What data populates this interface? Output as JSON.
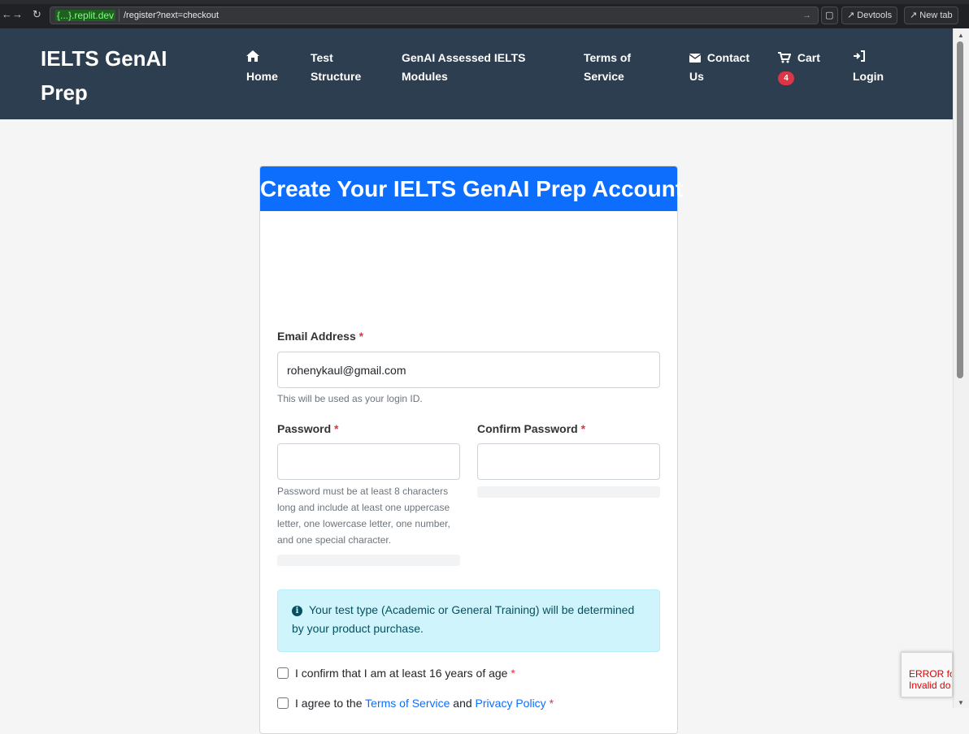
{
  "browser": {
    "url_host": "{...}.replit.dev",
    "url_path": "/register?next=checkout",
    "devtools_label": "Devtools",
    "new_tab_label": "New tab"
  },
  "navbar": {
    "brand": "IELTS GenAI Prep",
    "items": [
      {
        "icon": "home-icon",
        "label": "Home"
      },
      {
        "label": "Test Structure"
      },
      {
        "label": "GenAI Assessed IELTS Modules"
      },
      {
        "label": "Terms of Service"
      },
      {
        "icon": "envelope-icon",
        "label": "Contact Us"
      },
      {
        "icon": "cart-icon",
        "label": "Cart",
        "badge": "4"
      },
      {
        "icon": "sign-in-icon",
        "label": "Login"
      }
    ]
  },
  "form": {
    "title": "Create Your IELTS GenAI Prep Account",
    "email_label": "Email Address",
    "email_value": "rohenykaul@gmail.com",
    "email_help": "This will be used as your login ID.",
    "password_label": "Password",
    "password_help": "Password must be at least 8 characters long and include at least one uppercase letter, one lowercase letter, one number, and one special character.",
    "confirm_label": "Confirm Password",
    "required_marker": "*",
    "info_text": "Your test type (Academic or General Training) will be determined by your product purchase.",
    "age_check_label": "I confirm that I am at least 16 years of age",
    "terms_prefix": "I agree to the",
    "terms_link": "Terms of Service",
    "terms_and": "and",
    "privacy_link": "Privacy Policy"
  },
  "recaptcha": {
    "line1": "ERROR fo",
    "line2": "Invalid do"
  },
  "colors": {
    "navbar_bg": "#2d3e50",
    "primary": "#0d6efd",
    "required": "#dc3545",
    "info_bg": "#cff4fc"
  }
}
